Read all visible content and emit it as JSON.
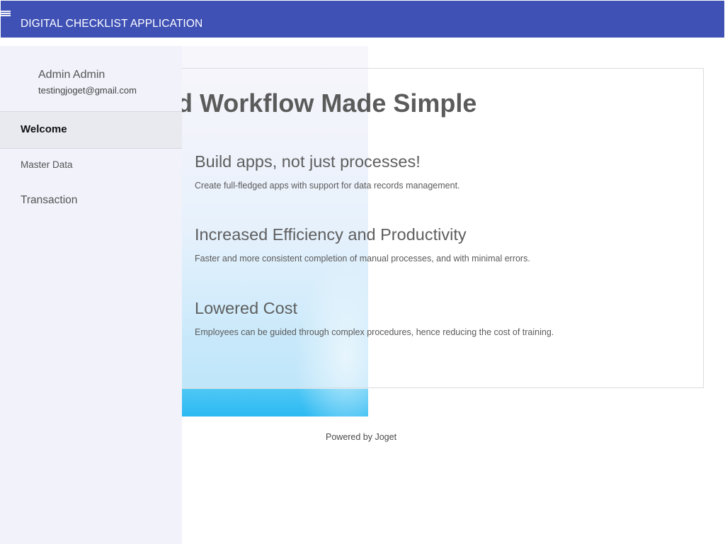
{
  "header": {
    "title": "DIGITAL CHECKLIST APPLICATION",
    "menu_icon": "hamburger-icon",
    "background_color": "#3f51b5"
  },
  "sidebar": {
    "user_name": "Admin Admin",
    "user_email": "testingjoget@gmail.com",
    "items": [
      {
        "label": "Welcome",
        "active": true
      },
      {
        "label": "Master Data",
        "active": false
      },
      {
        "label": "Transaction",
        "active": false
      }
    ],
    "background_color": "#f1f2fa"
  },
  "main": {
    "hero_title": "nd Workflow Made Simple",
    "features": [
      {
        "title": "Build apps, not just processes!",
        "description": "Create full-fledged apps with support for data records management."
      },
      {
        "title": "Increased Efficiency and Productivity",
        "description": "Faster and more consistent completion of manual processes, and with minimal errors."
      },
      {
        "title": "Lowered Cost",
        "description": "Employees can be guided through complex procedures, hence reducing the cost of training."
      }
    ]
  },
  "footer": {
    "powered_by": "Powered by Joget"
  }
}
